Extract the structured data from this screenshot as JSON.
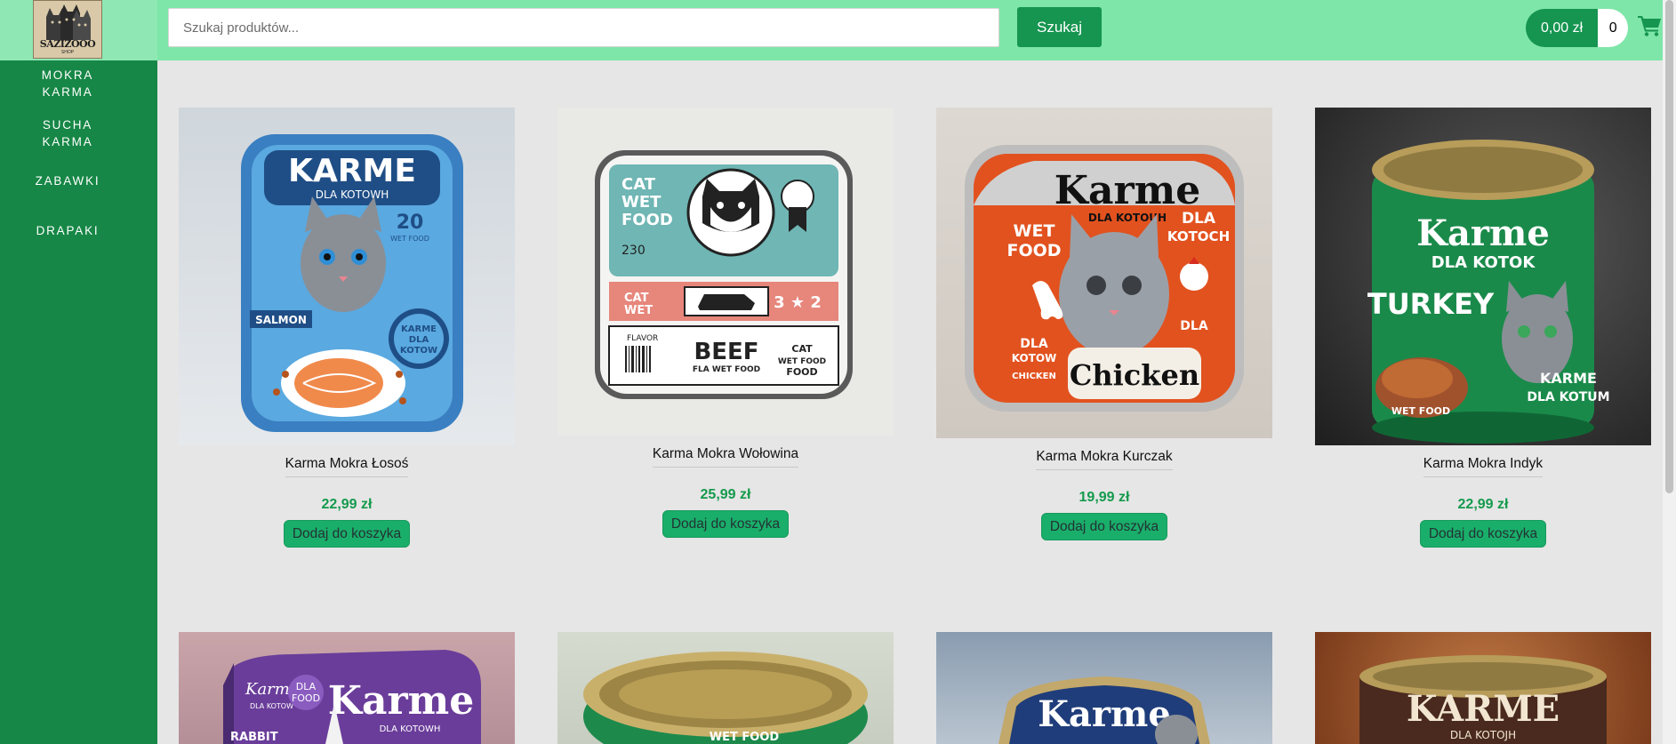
{
  "header": {
    "logo_text": "SAZIZOOO",
    "logo_subtext": "SHOP",
    "search_placeholder": "Szukaj produktów...",
    "search_button": "Szukaj",
    "cart_total": "0,00 zł",
    "cart_count": "0",
    "cart_icon": "shopping-cart-icon"
  },
  "sidebar": {
    "items": [
      {
        "label_line1": "MOKRA",
        "label_line2": "KARMA"
      },
      {
        "label_line1": "SUCHA",
        "label_line2": "KARMA"
      },
      {
        "label_line1": "ZABAWKI",
        "label_line2": ""
      },
      {
        "label_line1": "DRAPAKI",
        "label_line2": ""
      }
    ]
  },
  "products": [
    {
      "name": "Karma Mokra Łosoś",
      "price": "22,99 zł",
      "button": "Dodaj do koszyka",
      "brand": "KARME",
      "brand_sub": "DLA KOTOWH",
      "flavor": "SALMON",
      "badge": "KARME DLA KOTOW",
      "number": "20",
      "number_sub": "WET FOOD"
    },
    {
      "name": "Karma Mokra Wołowina",
      "price": "25,99 zł",
      "button": "Dodaj do koszyka",
      "line1": "CAT",
      "line2": "WET",
      "line3": "FOOD",
      "code": "230",
      "flavor": "BEEF",
      "flavor_sub": "FLA WET FOOD",
      "flavor_label": "FLAVOR",
      "side": "CAT WET FOOD",
      "rating": "3 ★ 2"
    },
    {
      "name": "Karma Mokra Kurczak",
      "price": "19,99 zł",
      "button": "Dodaj do koszyka",
      "brand": "Karme",
      "brand_sub": "DLA KOTOUH",
      "left": "WET FOOD",
      "right": "DLA KOTOCH",
      "flavor": "Chicken",
      "flavor_small": "CHICKEN",
      "dla": "DLA KOTOW"
    },
    {
      "name": "Karma Mokra Indyk",
      "price": "22,99 zł",
      "button": "Dodaj do koszyka",
      "brand": "Karme",
      "brand_sub": "DLA KOTOK",
      "flavor": "TURKEY",
      "badge": "KARME DLA KOTUM",
      "bottom": "WET FOOD"
    },
    {
      "brand": "Karme",
      "brand_sub": "DLA KOTOWH",
      "tag": "DLA FOOD",
      "flavor": "RABBIT"
    },
    {
      "brand": "WET FOOD"
    },
    {
      "brand": "Karme"
    },
    {
      "brand": "KARME",
      "brand_sub": "DLA KOTOJH"
    }
  ],
  "colors": {
    "topbar": "#7ee6a8",
    "sidebar": "#168746",
    "accent": "#159550",
    "price": "#149a4c",
    "add_button": "#1aae6b",
    "background": "#e6e6e6"
  }
}
